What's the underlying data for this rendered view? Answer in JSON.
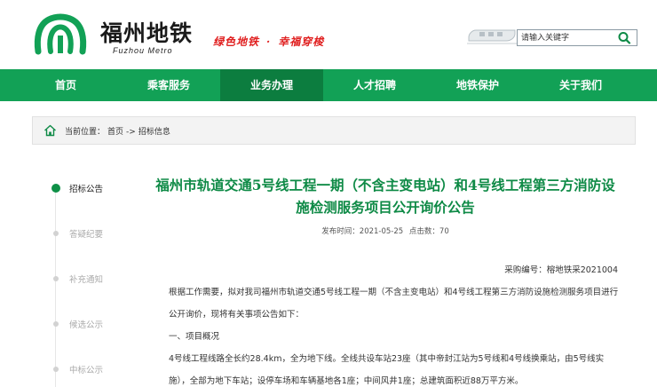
{
  "brand": {
    "name_cn": "福州地铁",
    "name_en": "Fuzhou Metro",
    "slogan_left": "绿色地铁",
    "slogan_right": "幸福穿梭",
    "colors": {
      "primary_green": "#12a156",
      "active_green": "#0c7d3f",
      "title_green": "#0e8a46",
      "slogan_red": "#e02020"
    }
  },
  "search": {
    "placeholder": "请输入关键字",
    "icon": "search-icon"
  },
  "nav": {
    "items": [
      {
        "label": "首页"
      },
      {
        "label": "乘客服务"
      },
      {
        "label": "业务办理",
        "active": true
      },
      {
        "label": "人才招聘"
      },
      {
        "label": "地铁保护"
      },
      {
        "label": "关于我们"
      }
    ]
  },
  "breadcrumb": {
    "prefix": "当前位置：",
    "home": "首页",
    "separator": "->",
    "current": "招标信息"
  },
  "timeline": {
    "items": [
      {
        "label": "招标公告",
        "active": true
      },
      {
        "label": "答疑纪要"
      },
      {
        "label": "补充通知"
      },
      {
        "label": "候选公示"
      },
      {
        "label": "中标公示"
      }
    ]
  },
  "article": {
    "title": "福州市轨道交通5号线工程一期（不含主变电站）和4号线工程第三方消防设施检测服务项目公开询价公告",
    "publish_label": "发布时间：",
    "publish_date": "2021-05-25",
    "clicks_label": "点击数：",
    "clicks": "70",
    "doc_no": "采购编号：榕地铁采2021004",
    "intro": "根据工作需要，拟对我司福州市轨道交通5号线工程一期（不含主变电站）和4号线工程第三方消防设施检测服务项目进行公开询价，现将有关事项公告如下：",
    "section1": "一、项目概况",
    "para1": "4号线工程线路全长约28.4km，全为地下线。全线共设车站23座（其中帝封江站为5号线和4号线换乘站，由5号线实施），全部为地下车站；设停车场和车辆基地各1座；中间风井1座；总建筑面积近88万平方米。"
  }
}
